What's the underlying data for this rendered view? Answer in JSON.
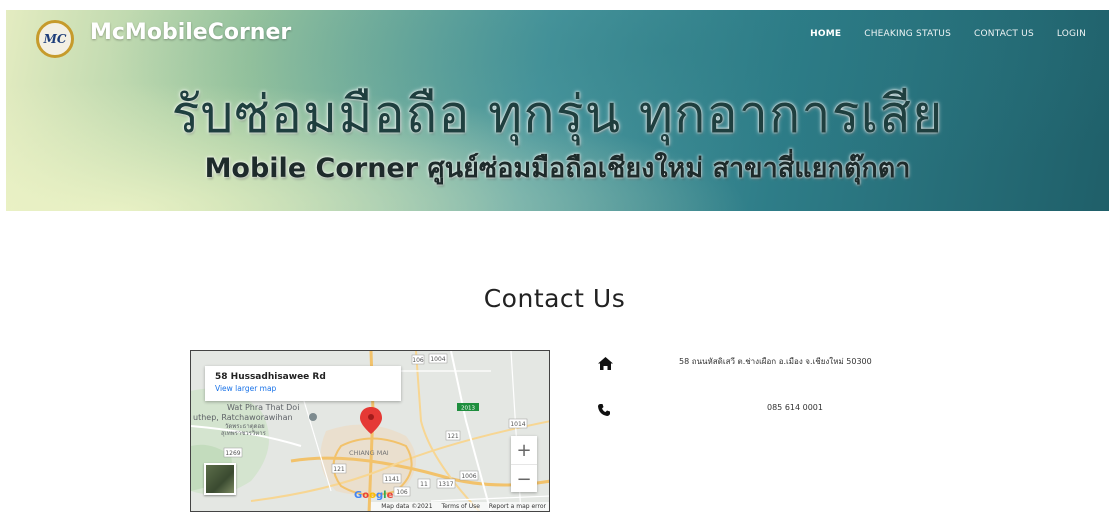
{
  "header": {
    "logo_text": "MC",
    "brand": "McMobileCorner",
    "nav": [
      {
        "label": "HOME"
      },
      {
        "label": "CHEAKING STATUS"
      },
      {
        "label": "CONTACT US"
      },
      {
        "label": "LOGIN"
      }
    ],
    "headline": "รับซ่อมมือถือ ทุกรุ่น ทุกอาการเสีย",
    "subheadline": "Mobile Corner ศูนย์ซ่อมมือถือเชียงใหม่ สาขาสี่แยกตุ๊กตา"
  },
  "contact": {
    "title": "Contact Us",
    "address": "58 ถนนหัสดิเสวี ต.ช่างเผือก อ.เมือง จ.เชียงใหม่ 50300",
    "phone": "085 614 0001",
    "icons": {
      "address": "home-icon",
      "phone": "phone-icon"
    }
  },
  "map": {
    "place_name": "58 Hussadhisawee Rd",
    "view_larger": "View larger map",
    "zoom_in": "+",
    "zoom_out": "−",
    "labels": {
      "wat": "Wat Phra That Doi",
      "suthep": "uthep, Ratchaworawihan",
      "thai1": "วัดพระธาตุดอย",
      "thai2": "สุเทพราชวรวิหาร",
      "city": "CHIANG MAI"
    },
    "road_numbers": [
      "1004",
      "121",
      "1269",
      "2013",
      "1014",
      "121",
      "1141",
      "106",
      "11",
      "1006",
      "1317",
      "106"
    ],
    "google": [
      "G",
      "o",
      "o",
      "g",
      "l",
      "e"
    ],
    "footer": {
      "data": "Map data ©2021",
      "terms": "Terms of Use",
      "report": "Report a map error"
    },
    "colors": {
      "pin": "#e53935",
      "roads": "#f2c26b",
      "water": "#aadaff",
      "land": "#dfe3e4"
    }
  }
}
